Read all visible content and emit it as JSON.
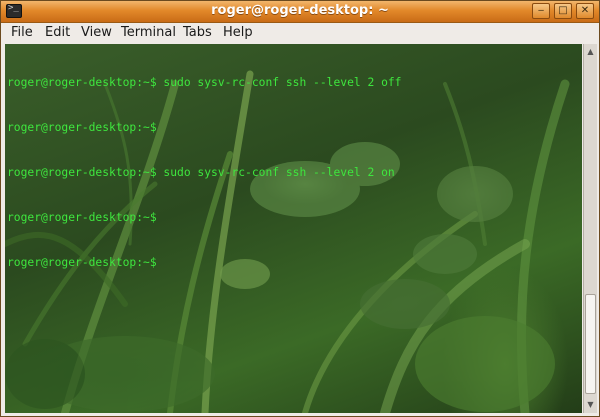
{
  "window": {
    "title": "roger@roger-desktop: ~",
    "controls": {
      "minimize": "‒",
      "maximize": "□",
      "close": "✕"
    },
    "icon": "terminal-icon"
  },
  "menu": {
    "items": [
      "File",
      "Edit",
      "View",
      "Terminal",
      "Tabs",
      "Help"
    ]
  },
  "terminal": {
    "lines": [
      "roger@roger-desktop:~$ sudo sysv-rc-conf ssh --level 2 off",
      "roger@roger-desktop:~$",
      "roger@roger-desktop:~$ sudo sysv-rc-conf ssh --level 2 on",
      "roger@roger-desktop:~$",
      "roger@roger-desktop:~$"
    ],
    "text_color": "#3ee63e"
  },
  "scrollbar": {
    "up": "▲",
    "down": "▼"
  },
  "colors": {
    "titlebar": "#e2892a",
    "menubar": "#efebe7"
  }
}
